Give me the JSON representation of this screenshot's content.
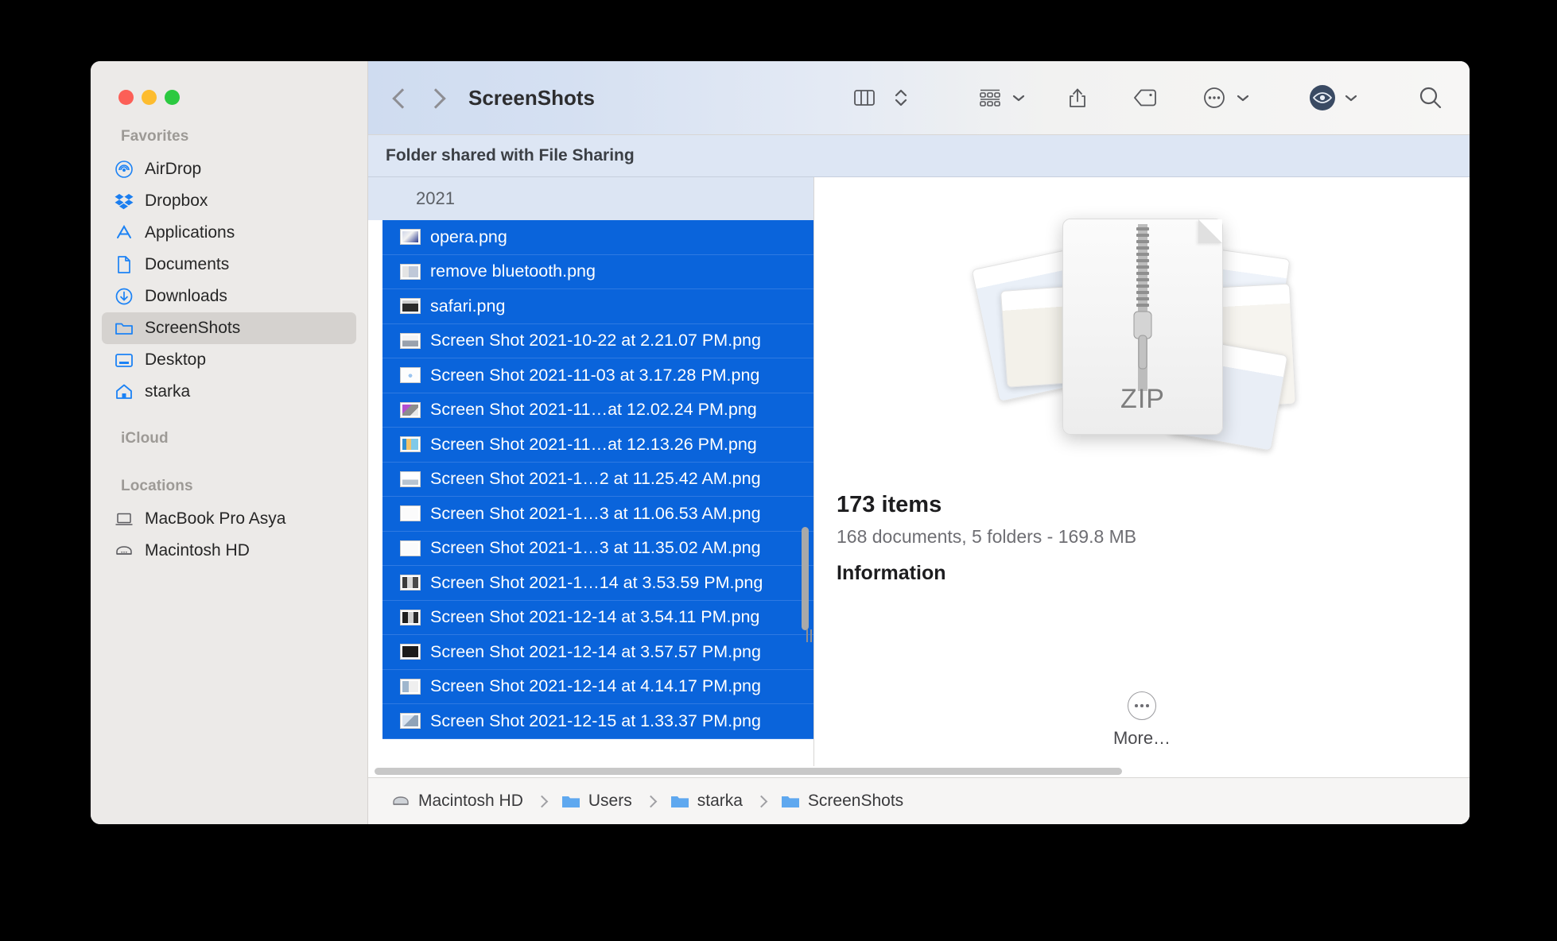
{
  "window": {
    "title": "ScreenShots",
    "traffic_lights": [
      "close",
      "minimize",
      "zoom"
    ]
  },
  "toolbar": {
    "back_label": "Back",
    "forward_label": "Forward",
    "view_columns_label": "Column View",
    "view_arrange_label": "Arrange",
    "group_label": "Group",
    "share_label": "Share",
    "tags_label": "Tags",
    "more_label": "More",
    "quicklook_label": "Quick Look",
    "search_label": "Search"
  },
  "share_banner": {
    "text": "Folder shared with File Sharing"
  },
  "sidebar": {
    "sections": [
      {
        "title": "Favorites",
        "items": [
          {
            "label": "AirDrop",
            "icon": "airdrop-icon",
            "selected": false
          },
          {
            "label": "Dropbox",
            "icon": "dropbox-icon",
            "selected": false
          },
          {
            "label": "Applications",
            "icon": "applications-icon",
            "selected": false
          },
          {
            "label": "Documents",
            "icon": "document-icon",
            "selected": false
          },
          {
            "label": "Downloads",
            "icon": "downloads-icon",
            "selected": false
          },
          {
            "label": "ScreenShots",
            "icon": "folder-icon",
            "selected": true
          },
          {
            "label": "Desktop",
            "icon": "desktop-icon",
            "selected": false
          },
          {
            "label": "starka",
            "icon": "home-icon",
            "selected": false
          }
        ]
      },
      {
        "title": "iCloud",
        "items": []
      },
      {
        "title": "Locations",
        "items": [
          {
            "label": "MacBook Pro Asya",
            "icon": "laptop-icon",
            "selected": false
          },
          {
            "label": "Macintosh HD",
            "icon": "harddisk-icon",
            "selected": false
          }
        ]
      }
    ]
  },
  "file_list": {
    "group_header": "2021",
    "rows": [
      {
        "name": "opera.png",
        "icon": "image-thumb",
        "selected": true
      },
      {
        "name": "remove bluetooth.png",
        "icon": "image-thumb",
        "selected": true
      },
      {
        "name": "safari.png",
        "icon": "image-thumb",
        "selected": true
      },
      {
        "name": "Screen Shot 2021-10-22 at 2.21.07 PM.png",
        "icon": "image-thumb",
        "selected": true
      },
      {
        "name": "Screen Shot 2021-11-03 at 3.17.28 PM.png",
        "icon": "image-thumb",
        "selected": true
      },
      {
        "name": "Screen Shot 2021-11…at 12.02.24 PM.png",
        "icon": "image-thumb",
        "selected": true
      },
      {
        "name": "Screen Shot 2021-11…at 12.13.26 PM.png",
        "icon": "image-thumb",
        "selected": true
      },
      {
        "name": "Screen Shot 2021-1…2 at 11.25.42 AM.png",
        "icon": "image-thumb",
        "selected": true
      },
      {
        "name": "Screen Shot 2021-1…3 at 11.06.53 AM.png",
        "icon": "image-thumb",
        "selected": true
      },
      {
        "name": "Screen Shot 2021-1…3 at 11.35.02 AM.png",
        "icon": "image-thumb",
        "selected": true
      },
      {
        "name": "Screen Shot 2021-1…14 at 3.53.59 PM.png",
        "icon": "image-thumb",
        "selected": true
      },
      {
        "name": "Screen Shot 2021-12-14 at 3.54.11 PM.png",
        "icon": "image-thumb",
        "selected": true
      },
      {
        "name": "Screen Shot 2021-12-14 at 3.57.57 PM.png",
        "icon": "image-thumb",
        "selected": true
      },
      {
        "name": "Screen Shot 2021-12-14 at 4.14.17 PM.png",
        "icon": "image-thumb",
        "selected": true
      },
      {
        "name": "Screen Shot 2021-12-15 at 1.33.37 PM.png",
        "icon": "image-thumb",
        "selected": true
      }
    ]
  },
  "preview": {
    "file_type_label": "ZIP",
    "item_count": "173 items",
    "item_details": "168 documents, 5 folders - 169.8 MB",
    "information_heading": "Information",
    "more_label": "More…"
  },
  "path_bar": {
    "crumbs": [
      {
        "label": "Macintosh HD",
        "icon": "harddisk-icon"
      },
      {
        "label": "Users",
        "icon": "folder-blue-icon"
      },
      {
        "label": "starka",
        "icon": "folder-blue-icon"
      },
      {
        "label": "ScreenShots",
        "icon": "folder-blue-icon"
      }
    ]
  },
  "colors": {
    "selection_blue": "#0a64db",
    "accent_blue": "#1b82f5",
    "sidebar_bg": "#eceae8",
    "banner_bg": "#dde6f4"
  }
}
